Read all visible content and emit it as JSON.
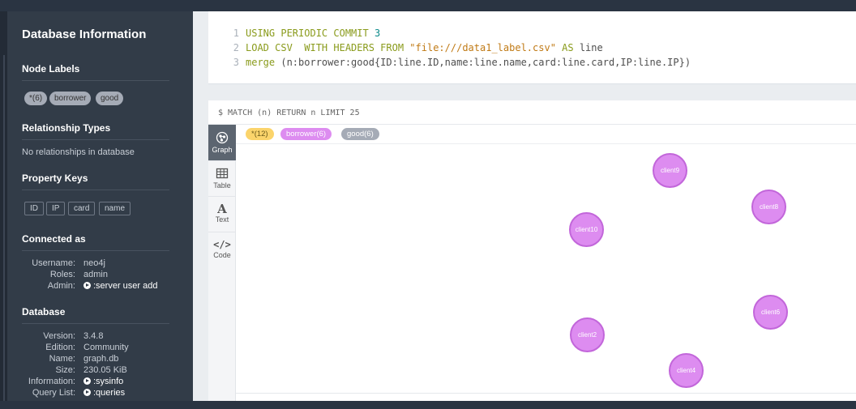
{
  "sidebar": {
    "title": "Database Information",
    "node_labels": {
      "heading": "Node Labels",
      "items": [
        "*(6)",
        "borrower",
        "good"
      ]
    },
    "relationship_types": {
      "heading": "Relationship Types",
      "empty_text": "No relationships in database"
    },
    "property_keys": {
      "heading": "Property Keys",
      "items": [
        "ID",
        "IP",
        "card",
        "name"
      ]
    },
    "connected_as": {
      "heading": "Connected as",
      "username_label": "Username:",
      "username": "neo4j",
      "roles_label": "Roles:",
      "roles": "admin",
      "admin_label": "Admin:",
      "admin_link": ":server user add"
    },
    "database": {
      "heading": "Database",
      "version_label": "Version:",
      "version": "3.4.8",
      "edition_label": "Edition:",
      "edition": "Community",
      "name_label": "Name:",
      "name": "graph.db",
      "size_label": "Size:",
      "size": "230.05 KiB",
      "information_label": "Information:",
      "information_link": ":sysinfo",
      "querylist_label": "Query List:",
      "querylist_link": ":queries"
    }
  },
  "editor": {
    "lines": [
      {
        "num": "1",
        "kw1": "USING PERIODIC COMMIT ",
        "n": "3"
      },
      {
        "num": "2",
        "kw1": "LOAD CSV  WITH HEADERS FROM ",
        "s": "\"file:///data1_label.csv\"",
        "kw2": " AS ",
        "p": "line"
      },
      {
        "num": "3",
        "kw1": "merge ",
        "p": "(n:borrower:good{ID:line.ID,name:line.name,card:line.card,IP:line.IP})"
      }
    ]
  },
  "result": {
    "query": "$ MATCH (n) RETURN n LIMIT 25",
    "tabs": [
      "Graph",
      "Table",
      "Text",
      "Code"
    ],
    "legend": [
      {
        "label": "*(12)",
        "color": "#fbd46b",
        "text_color": "#6b5a1a"
      },
      {
        "label": "borrower(6)",
        "color": "#dd8cf0",
        "text_color": "#ffffff"
      },
      {
        "label": "good(6)",
        "color": "#a5abb6",
        "text_color": "#ffffff"
      }
    ],
    "nodes": [
      "client9",
      "client8",
      "client10",
      "client6",
      "client2",
      "client4"
    ]
  },
  "colors": {
    "node_fill": "#dd8cf0",
    "node_border": "#c266da",
    "sidebar_bg": "#323c48"
  }
}
